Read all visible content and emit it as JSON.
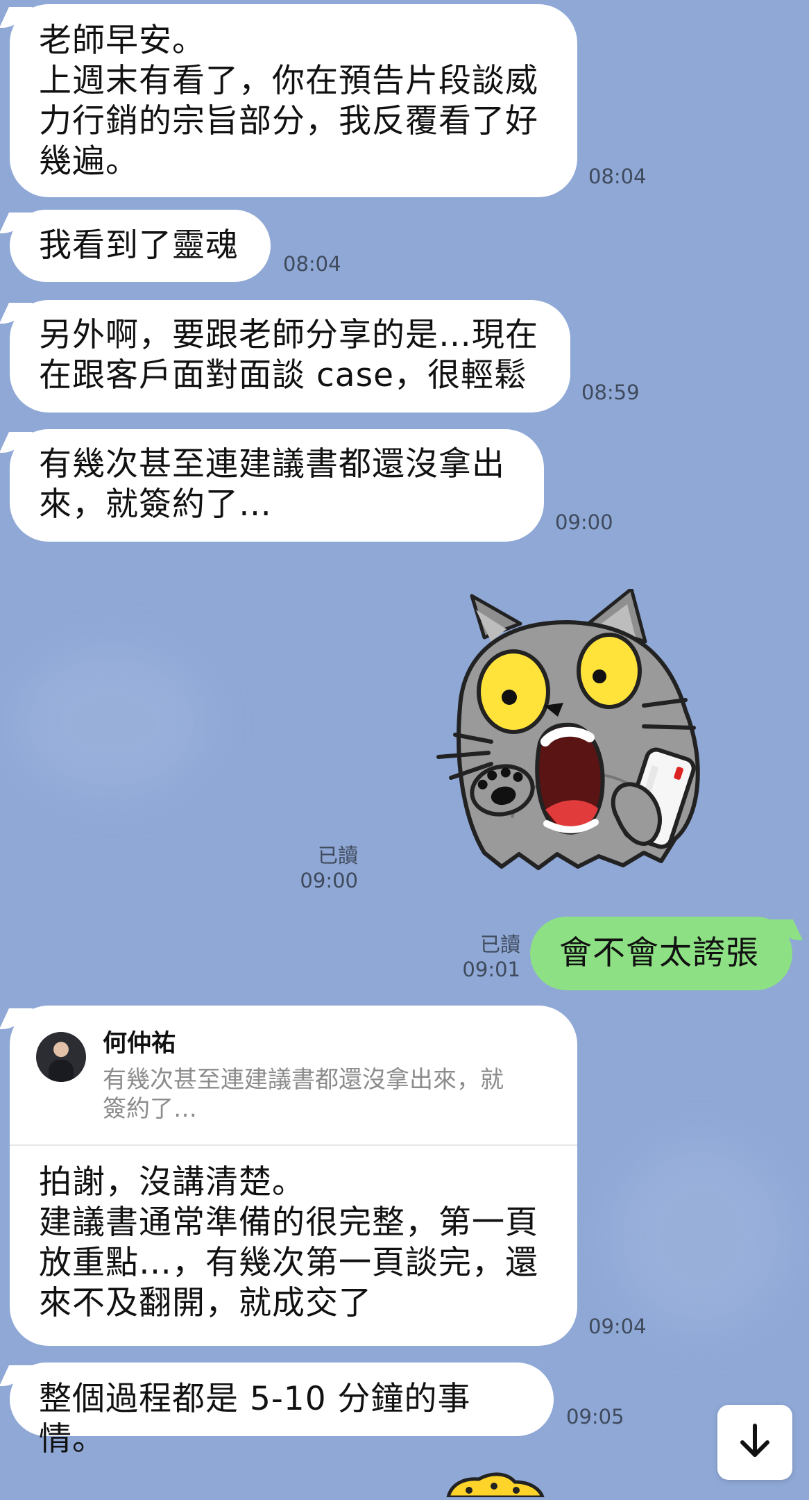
{
  "messages": [
    {
      "id": "m1",
      "text": "老師早安。\n上週末有看了，你在預告片段談威\n力行銷的宗旨部分，我反覆看了好\n幾遍。",
      "time": "08:04"
    },
    {
      "id": "m2",
      "text": "我看到了靈魂",
      "time": "08:04"
    },
    {
      "id": "m3",
      "text": "另外啊，要跟老師分享的是…現在\n在跟客戶面對面談 case，很輕鬆",
      "time": "08:59"
    },
    {
      "id": "m4",
      "text": "有幾次甚至連建議書都還沒拿出\n來，就簽約了…",
      "time": "09:00"
    },
    {
      "id": "sticker1",
      "sticker": "shocked-gray-cat-with-phone",
      "read_label": "已讀",
      "time": "09:00"
    },
    {
      "id": "m5",
      "text": "會不會太誇張",
      "read_label": "已讀",
      "time": "09:01"
    },
    {
      "id": "m6",
      "quote": {
        "name": "何仲祐",
        "text": "有幾次甚至連建議書都還沒拿出來，就\n簽約了…"
      },
      "text": "拍謝，沒講清楚。\n建議書通常準備的很完整，第一頁\n放重點…，有幾次第一頁談完，還\n來不及翻開，就成交了",
      "time": "09:04"
    },
    {
      "id": "m7",
      "text": "整個過程都是 5-10 分鐘的事情。",
      "time": "09:05"
    }
  ],
  "colors": {
    "background": "#8fa8d6",
    "incoming_bubble": "#ffffff",
    "outgoing_bubble": "#8de184",
    "timestamp": "#3f4a5c"
  },
  "icons": {
    "scroll_down": "arrow-down-icon"
  }
}
